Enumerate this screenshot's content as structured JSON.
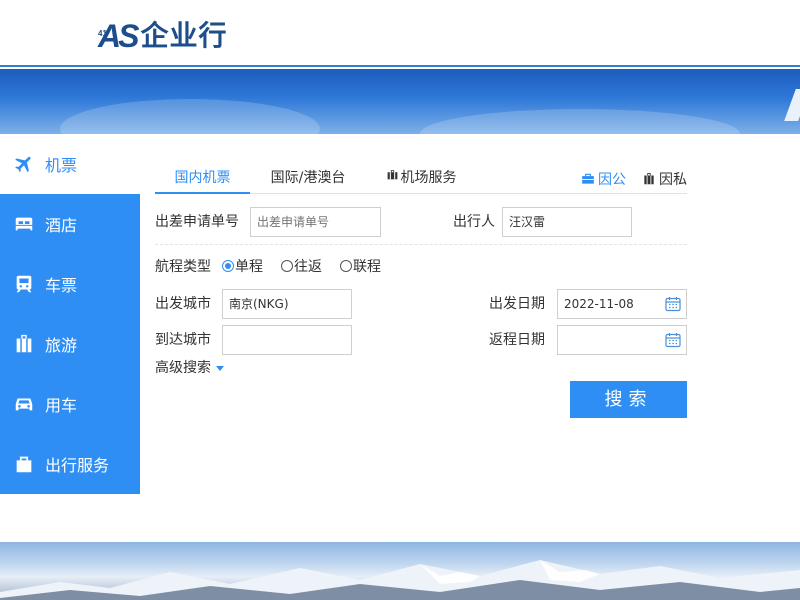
{
  "brand": {
    "logo_mark": "AS",
    "logo_small": "41",
    "name": "企业行"
  },
  "sidebar": {
    "items": [
      {
        "label": "机票",
        "icon": "plane-icon",
        "active": true
      },
      {
        "label": "酒店",
        "icon": "hotel-bed-icon",
        "active": false
      },
      {
        "label": "车票",
        "icon": "train-icon",
        "active": false
      },
      {
        "label": "旅游",
        "icon": "luggage-icon",
        "active": false
      },
      {
        "label": "用车",
        "icon": "car-icon",
        "active": false
      },
      {
        "label": "出行服务",
        "icon": "bag-icon",
        "active": false
      }
    ]
  },
  "tabs": [
    {
      "label": "国内机票",
      "active": true
    },
    {
      "label": "国际/港澳台",
      "active": false
    },
    {
      "label": "机场服务",
      "active": false,
      "icon": "luggage-cart-icon"
    }
  ],
  "modes": {
    "business": {
      "label": "因公",
      "icon": "briefcase-icon"
    },
    "private": {
      "label": "因私",
      "icon": "suitcase-icon"
    }
  },
  "form": {
    "application_no": {
      "label": "出差申请单号",
      "placeholder": "出差申请单号",
      "value": ""
    },
    "traveler": {
      "label": "出行人",
      "value": "汪汉雷"
    },
    "trip_type": {
      "label": "航程类型",
      "options": [
        "单程",
        "往返",
        "联程"
      ],
      "selected": "单程"
    },
    "departure_city": {
      "label": "出发城市",
      "value": "南京(NKG)"
    },
    "arrival_city": {
      "label": "到达城市",
      "value": ""
    },
    "departure_date": {
      "label": "出发日期",
      "value": "2022-11-08",
      "icon": "calendar-icon"
    },
    "return_date": {
      "label": "返程日期",
      "value": "",
      "icon": "calendar-icon"
    },
    "advanced_search": "高级搜索",
    "search_button": "搜索"
  },
  "colors": {
    "accent": "#2f8ef4",
    "brand": "#1e4d8c",
    "banner": "#2f79d8"
  }
}
